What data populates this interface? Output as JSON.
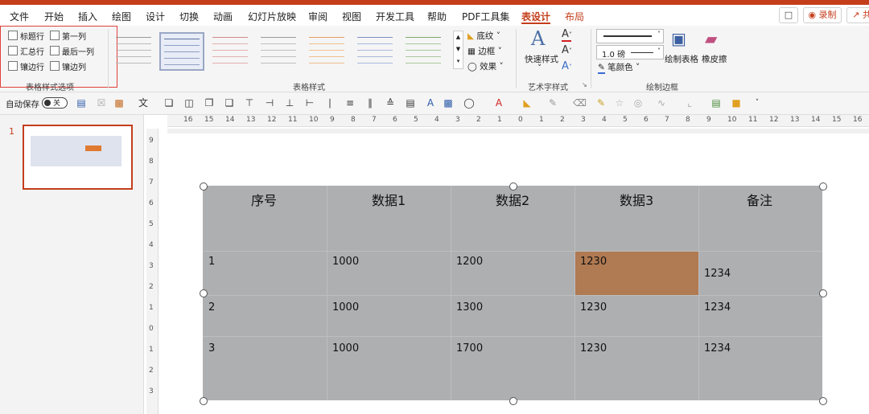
{
  "menu": {
    "tabs": [
      "文件",
      "开始",
      "插入",
      "绘图",
      "设计",
      "切换",
      "动画",
      "幻灯片放映",
      "审阅",
      "视图",
      "开发工具",
      "帮助",
      "PDF工具集",
      "表设计",
      "布局"
    ],
    "active_tab": "表设计",
    "comment_icon": "comment-icon",
    "record_label": "录制",
    "share_label": "共"
  },
  "ribbon": {
    "table_style_options": {
      "checkboxes": [
        "标题行",
        "第一列",
        "汇总行",
        "最后一列",
        "镶边行",
        "镶边列"
      ],
      "group_label": "表格样式选项"
    },
    "table_styles": {
      "group_label": "表格样式",
      "shading_label": "底纹",
      "border_label": "边框",
      "effects_label": "效果"
    },
    "wordart": {
      "quick_style_label": "快速样式",
      "group_label": "艺术字样式"
    },
    "draw_borders": {
      "weight_label": "1.0 磅",
      "pen_color_label": "笔颜色",
      "draw_table_label": "绘制表格",
      "eraser_label": "橡皮擦",
      "group_label": "绘制边框"
    }
  },
  "toolbar": {
    "autosave_label": "自动保存",
    "toggle_label": "关"
  },
  "slides": {
    "slide_number": "1"
  },
  "ruler": {
    "h_numbers": [
      "16",
      "15",
      "14",
      "13",
      "12",
      "11",
      "10",
      "9",
      "8",
      "7",
      "6",
      "5",
      "4",
      "3",
      "2",
      "1",
      "0",
      "1",
      "2",
      "3",
      "4",
      "5",
      "6",
      "7",
      "8",
      "9",
      "10",
      "11",
      "12",
      "13",
      "14",
      "15",
      "16"
    ],
    "v_numbers": [
      "9",
      "8",
      "7",
      "6",
      "5",
      "4",
      "3",
      "2",
      "1",
      "0",
      "1",
      "2",
      "3"
    ]
  },
  "table": {
    "headers": [
      "序号",
      "数据1",
      "数据2",
      "数据3",
      "备注"
    ],
    "rows": [
      [
        "1",
        "1000",
        "1200",
        "1230",
        "1234"
      ],
      [
        "2",
        "1000",
        "1300",
        "1230",
        "1234"
      ],
      [
        "3",
        "1000",
        "1700",
        "1230",
        "1234"
      ]
    ],
    "highlight_color": "#b07a52",
    "fill_color": "#aeafb1"
  },
  "colors": {
    "accent": "#c43e1c"
  }
}
